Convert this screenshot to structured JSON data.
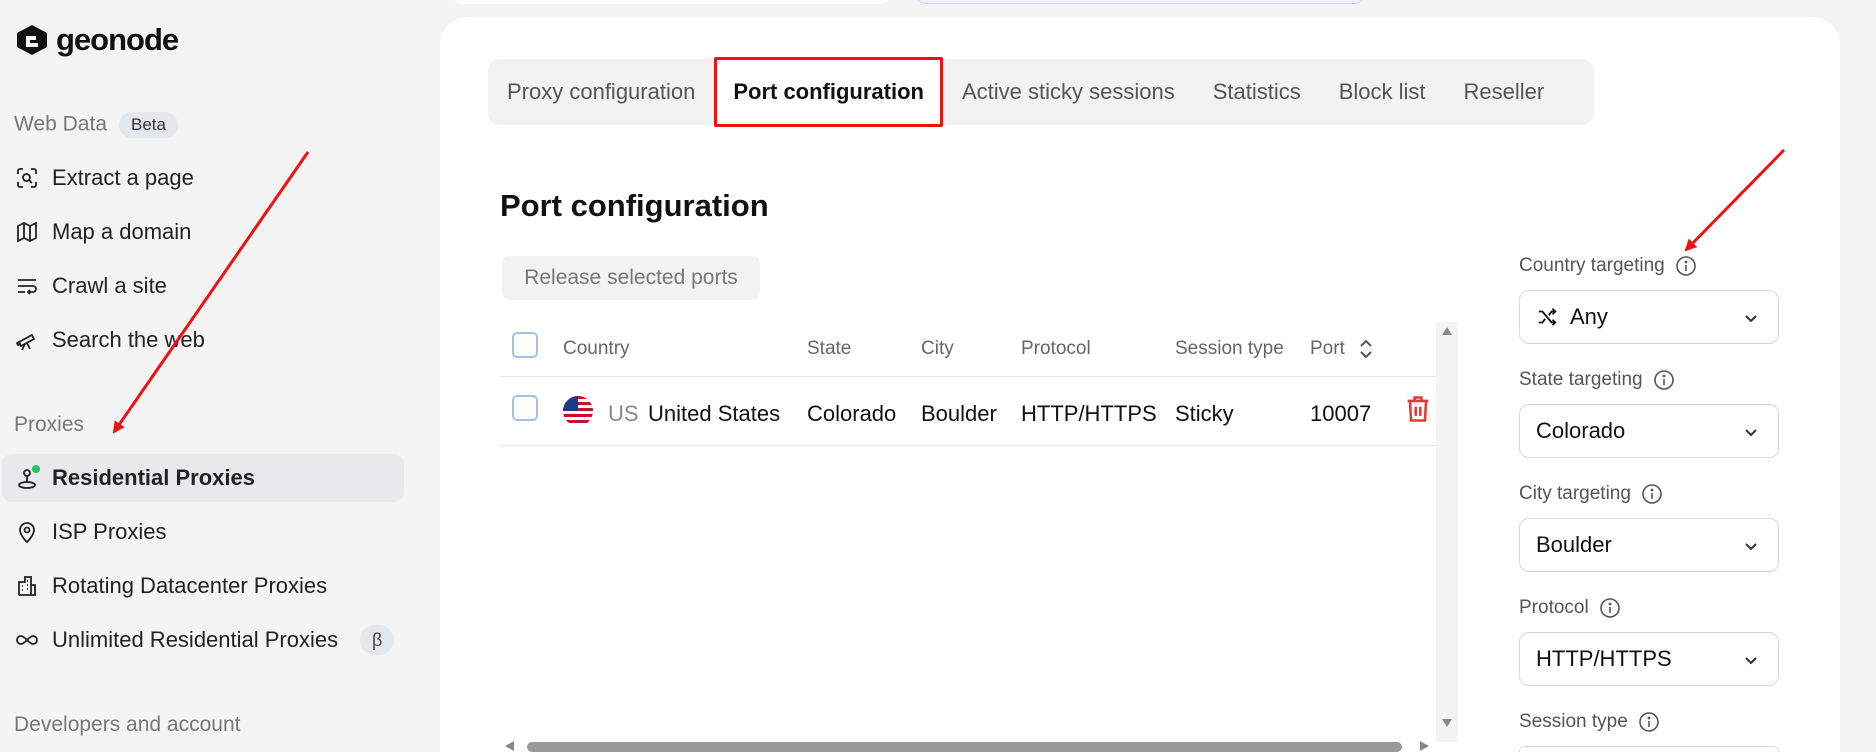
{
  "brand": {
    "name": "geonode"
  },
  "sidebar": {
    "web_data_label": "Web Data",
    "web_data_badge": "Beta",
    "web_data_items": [
      {
        "label": "Extract a page",
        "icon": "scan-icon"
      },
      {
        "label": "Map a domain",
        "icon": "map-icon"
      },
      {
        "label": "Crawl a site",
        "icon": "crawl-icon"
      },
      {
        "label": "Search the web",
        "icon": "telescope-icon"
      }
    ],
    "proxies_label": "Proxies",
    "proxy_items": [
      {
        "label": "Residential Proxies",
        "icon": "location-pin-icon",
        "active": true
      },
      {
        "label": "ISP Proxies",
        "icon": "map-pin-icon"
      },
      {
        "label": "Rotating Datacenter Proxies",
        "icon": "building-icon"
      },
      {
        "label": "Unlimited Residential Proxies",
        "icon": "infinity-icon",
        "badge": "β"
      }
    ],
    "developers_label": "Developers and account"
  },
  "tabs": [
    {
      "label": "Proxy configuration"
    },
    {
      "label": "Port configuration",
      "active": true
    },
    {
      "label": "Active sticky sessions"
    },
    {
      "label": "Statistics"
    },
    {
      "label": "Block list"
    },
    {
      "label": "Reseller"
    }
  ],
  "main": {
    "title": "Port configuration",
    "release_button": "Release selected ports"
  },
  "table": {
    "headers": [
      "Country",
      "State",
      "City",
      "Protocol",
      "Session type",
      "Port"
    ],
    "rows": [
      {
        "country_code": "US",
        "country": "United States",
        "state": "Colorado",
        "city": "Boulder",
        "protocol": "HTTP/HTTPS",
        "session_type": "Sticky",
        "port": "10007"
      }
    ]
  },
  "filters": {
    "country": {
      "label": "Country targeting",
      "value": "Any"
    },
    "state": {
      "label": "State targeting",
      "value": "Colorado"
    },
    "city": {
      "label": "City targeting",
      "value": "Boulder"
    },
    "protocol": {
      "label": "Protocol",
      "value": "HTTP/HTTPS"
    },
    "session": {
      "label": "Session type"
    }
  },
  "colors": {
    "accent_red": "#e11111",
    "delete_red": "#e53935",
    "active_dot": "#22c55e"
  }
}
